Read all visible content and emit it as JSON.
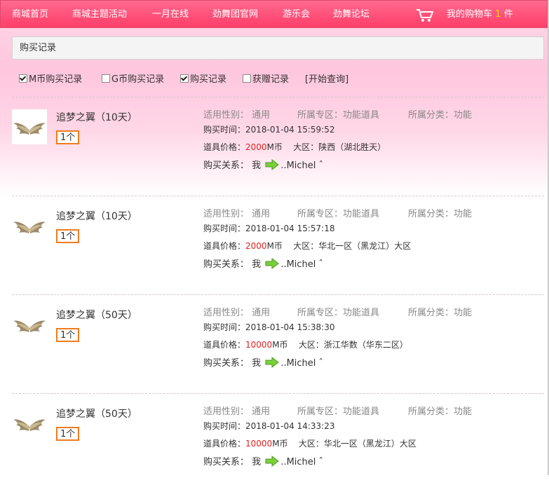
{
  "nav": {
    "items": [
      "商城首页",
      "商城主题活动",
      "一月在线",
      "劲舞团官网",
      "游乐会",
      "劲舞论坛"
    ],
    "cart_label": "我的购物车",
    "cart_count": "1",
    "cart_unit": "件"
  },
  "section_title": "购买记录",
  "filters": [
    {
      "label": "M币购买记录",
      "checked": true
    },
    {
      "label": "G币购买记录",
      "checked": false
    },
    {
      "label": "购买记录",
      "checked": true
    },
    {
      "label": "获赠记录",
      "checked": false
    }
  ],
  "query_link": "[开始查询]",
  "labels": {
    "gender": "适用性别：",
    "zone": "所属专区：",
    "category": "所属分类：",
    "time": "购买时间：",
    "price": "道具价格：",
    "region": "大区：",
    "relation": "购买关系：",
    "me": "我"
  },
  "records": [
    {
      "name": "追梦之翼（10天）",
      "qty": "1个",
      "gender": "通用",
      "zone": "功能道具",
      "category": "功能",
      "time": "2018-01-04 15:59:52",
      "price": "2000",
      "currency": "M币",
      "region": "陕西（湖北胜天）",
      "sender": "..Michel ˆ"
    },
    {
      "name": "追梦之翼（10天）",
      "qty": "1个",
      "gender": "通用",
      "zone": "功能道具",
      "category": "功能",
      "time": "2018-01-04 15:57:18",
      "price": "2000",
      "currency": "M币",
      "region": "华北一区（黑龙江）大区",
      "sender": "..Michel ˆ"
    },
    {
      "name": "追梦之翼（50天）",
      "qty": "1个",
      "gender": "通用",
      "zone": "功能道具",
      "category": "功能",
      "time": "2018-01-04 15:38:30",
      "price": "10000",
      "currency": "M币",
      "region": "浙江华数（华东二区）",
      "sender": "..Michel ˆ"
    },
    {
      "name": "追梦之翼（50天）",
      "qty": "1个",
      "gender": "通用",
      "zone": "功能道具",
      "category": "功能",
      "time": "2018-01-04 14:33:23",
      "price": "10000",
      "currency": "M币",
      "region": "华北一区（黑龙江）大区",
      "sender": "..Michel ˆ"
    }
  ]
}
